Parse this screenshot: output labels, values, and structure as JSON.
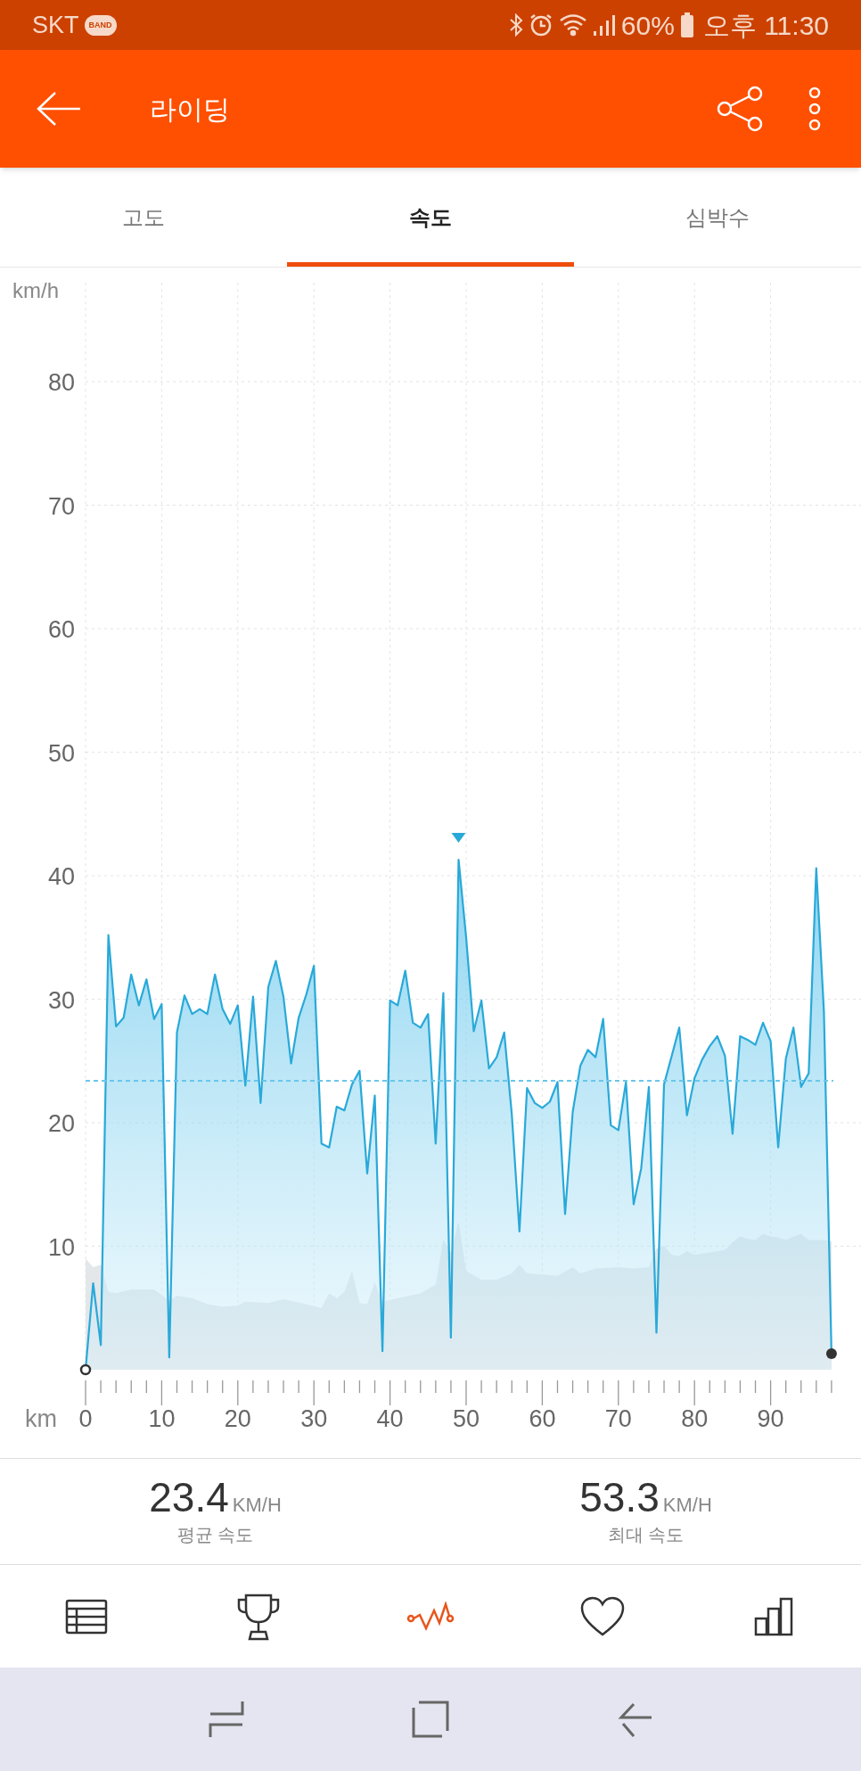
{
  "status_bar": {
    "carrier": "SKT",
    "badge": "BAND",
    "battery": "60%",
    "time": "오후 11:30"
  },
  "header": {
    "title": "라이딩"
  },
  "tabs": [
    {
      "label": "고도",
      "selected": false
    },
    {
      "label": "속도",
      "selected": true
    },
    {
      "label": "심박수",
      "selected": false
    }
  ],
  "chart": {
    "chart_data": {
      "type": "area",
      "xlabel": "km",
      "ylabel": "km/h",
      "x": [
        0,
        1,
        2,
        3,
        4,
        5,
        6,
        7,
        8,
        9,
        10,
        11,
        12,
        13,
        14,
        15,
        16,
        17,
        18,
        19,
        20,
        21,
        22,
        23,
        24,
        25,
        26,
        27,
        28,
        29,
        30,
        31,
        32,
        33,
        34,
        35,
        36,
        37,
        38,
        39,
        40,
        41,
        42,
        43,
        44,
        45,
        46,
        47,
        48,
        49,
        50,
        51,
        52,
        53,
        54,
        55,
        56,
        57,
        58,
        59,
        60,
        61,
        62,
        63,
        64,
        65,
        66,
        67,
        68,
        69,
        70,
        71,
        72,
        73,
        74,
        75,
        76,
        77,
        78,
        79,
        80,
        81,
        82,
        83,
        84,
        85,
        86,
        87,
        88,
        89,
        90,
        91,
        92,
        93,
        94,
        95,
        96,
        97,
        98
      ],
      "series": [
        {
          "color": "#29a9d9",
          "values": [
            0,
            7,
            2,
            35.2,
            27.8,
            28.5,
            32,
            29.5,
            31.6,
            28.4,
            29.6,
            1,
            27.3,
            30.3,
            28.8,
            29.2,
            28.8,
            32,
            29.2,
            28,
            29.5,
            23,
            30.2,
            21.6,
            31,
            33.1,
            30.2,
            24.8,
            28.5,
            30.4,
            32.7,
            18.3,
            18,
            21.3,
            21,
            23.1,
            24.2,
            15.9,
            22.2,
            1.5,
            29.9,
            29.5,
            32.3,
            28.1,
            27.7,
            28.8,
            18.3,
            30.5,
            2.6,
            41.3,
            35,
            27.4,
            29.9,
            24.4,
            25.3,
            27.3,
            20.7,
            11.2,
            22.8,
            21.6,
            21.2,
            21.7,
            23.3,
            12.6,
            20.9,
            24.6,
            25.9,
            25.3,
            28.4,
            19.8,
            19.4,
            23.3,
            13.4,
            16.3,
            22.9,
            3,
            23.1,
            25.4,
            27.7,
            20.6,
            23.6,
            25.1,
            26.2,
            27,
            25.4,
            19.1,
            27,
            26.7,
            26.3,
            28.1,
            26.6,
            18,
            25.2,
            27.7,
            22.9,
            24,
            40.6,
            29,
            1.3
          ]
        }
      ],
      "xlim": [
        0,
        98
      ],
      "ylim": [
        0,
        88
      ],
      "xticks": [
        0,
        10,
        20,
        30,
        40,
        50,
        60,
        70,
        80,
        90
      ],
      "yticks": [
        10,
        20,
        30,
        40,
        50,
        60,
        70,
        80
      ],
      "grid": true,
      "ref_lines": [
        {
          "axis": "y",
          "value": 23.4
        }
      ]
    }
  },
  "stats": [
    {
      "value": "23.4",
      "unit": "KM/H",
      "label": "평균 속도"
    },
    {
      "value": "53.3",
      "unit": "KM/H",
      "label": "최대 속도"
    }
  ],
  "bottom_nav": [
    {
      "selected": false
    },
    {
      "selected": false
    },
    {
      "selected": true
    },
    {
      "selected": false
    },
    {
      "selected": false
    }
  ]
}
